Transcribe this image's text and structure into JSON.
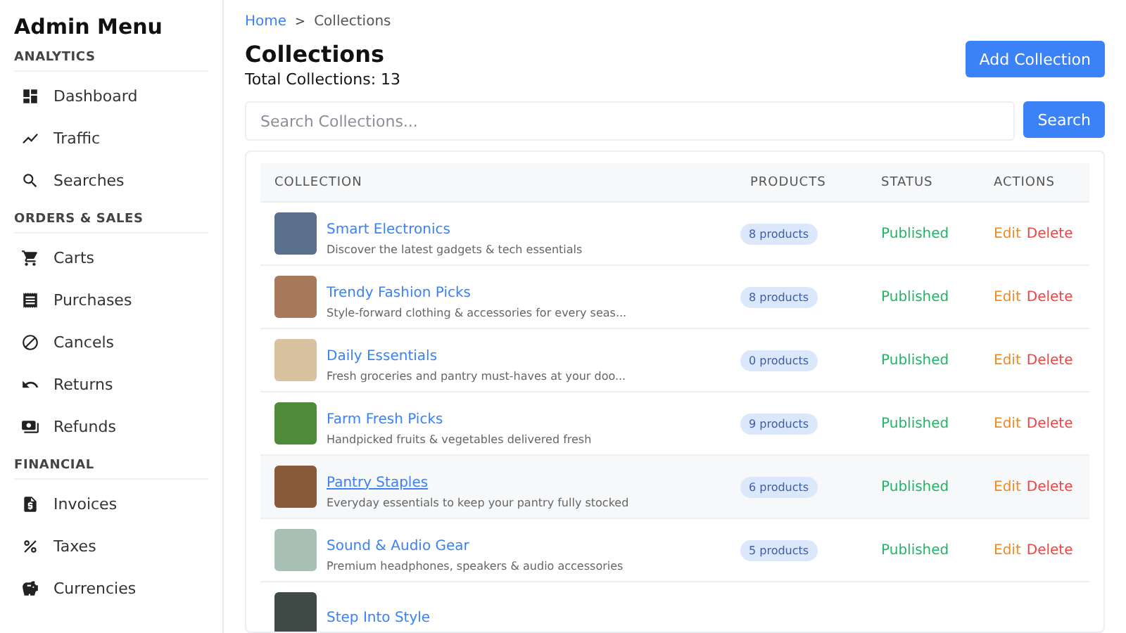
{
  "sidebar": {
    "title": "Admin Menu",
    "sections": [
      {
        "heading": "ANALYTICS",
        "items": [
          {
            "label": "Dashboard"
          },
          {
            "label": "Traffic"
          },
          {
            "label": "Searches"
          }
        ]
      },
      {
        "heading": "ORDERS & SALES",
        "items": [
          {
            "label": "Carts"
          },
          {
            "label": "Purchases"
          },
          {
            "label": "Cancels"
          },
          {
            "label": "Returns"
          },
          {
            "label": "Refunds"
          }
        ]
      },
      {
        "heading": "FINANCIAL",
        "items": [
          {
            "label": "Invoices"
          },
          {
            "label": "Taxes"
          },
          {
            "label": "Currencies"
          }
        ]
      }
    ]
  },
  "breadcrumb": {
    "separator": ">",
    "items": [
      "Home",
      "Collections"
    ]
  },
  "header": {
    "title": "Collections",
    "subtitle": "Total Collections: 13",
    "add_button": "Add Collection"
  },
  "search": {
    "placeholder": "Search Collections...",
    "button": "Search"
  },
  "table": {
    "columns": [
      "COLLECTION",
      "PRODUCTS",
      "STATUS",
      "ACTIONS"
    ],
    "rows": [
      {
        "name": "Smart Electronics",
        "description": "Discover the latest gadgets & tech essentials",
        "products": "8 products",
        "status": "Published",
        "edit": "Edit",
        "delete": "Delete",
        "hovered": false
      },
      {
        "name": "Trendy Fashion Picks",
        "description": "Style-forward clothing & accessories for every seas...",
        "products": "8 products",
        "status": "Published",
        "edit": "Edit",
        "delete": "Delete",
        "hovered": false
      },
      {
        "name": "Daily Essentials",
        "description": "Fresh groceries and pantry must-haves at your doo...",
        "products": "0 products",
        "status": "Published",
        "edit": "Edit",
        "delete": "Delete",
        "hovered": false
      },
      {
        "name": "Farm Fresh Picks",
        "description": "Handpicked fruits & vegetables delivered fresh",
        "products": "9 products",
        "status": "Published",
        "edit": "Edit",
        "delete": "Delete",
        "hovered": false
      },
      {
        "name": "Pantry Staples",
        "description": "Everyday essentials to keep your pantry fully stocked",
        "products": "6 products",
        "status": "Published",
        "edit": "Edit",
        "delete": "Delete",
        "hovered": true
      },
      {
        "name": "Sound & Audio Gear",
        "description": "Premium headphones, speakers & audio accessories",
        "products": "5 products",
        "status": "Published",
        "edit": "Edit",
        "delete": "Delete",
        "hovered": false
      },
      {
        "name": "Step Into Style"
      }
    ]
  }
}
